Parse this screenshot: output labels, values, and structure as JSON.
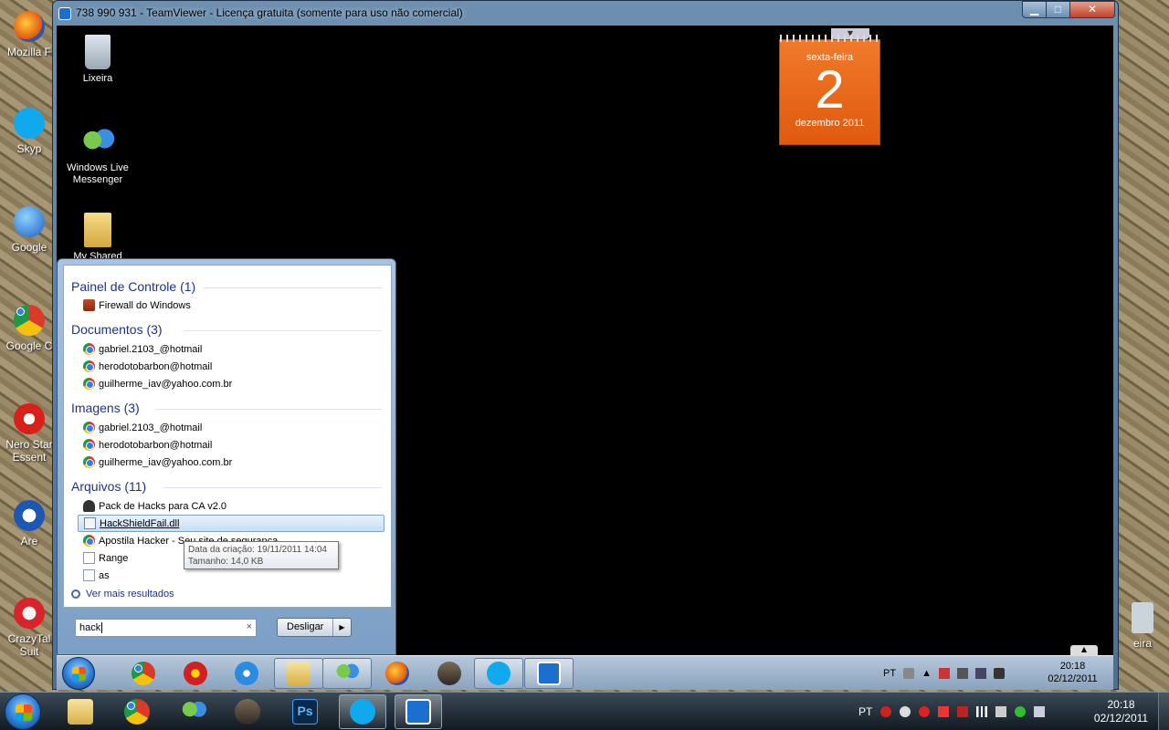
{
  "outer_desktop": {
    "icons": [
      {
        "label": "Mozilla F",
        "icon": "firefox-icon"
      },
      {
        "label": "Skyp",
        "icon": "skype-icon"
      },
      {
        "label": "Google",
        "icon": "google-earth-icon"
      },
      {
        "label": "Google C",
        "icon": "chrome-icon"
      },
      {
        "label": "Nero Star\nEssent",
        "icon": "nero-icon"
      },
      {
        "label": "Are",
        "icon": "ares-icon"
      },
      {
        "label": "CrazyTal\nSuit",
        "icon": "crazytalk-icon"
      }
    ],
    "right_icon_label": "eira"
  },
  "teamviewer": {
    "title": "738 990 931 - TeamViewer - Licença gratuita (somente para uso não comercial)",
    "min_glyph": "▁",
    "max_glyph": "□",
    "close_glyph": "✕"
  },
  "remote_desktop": {
    "icons": [
      {
        "label": "Lixeira",
        "icon": "recycle-bin-icon"
      },
      {
        "label": "Windows Live\nMessenger",
        "icon": "messenger-icon"
      },
      {
        "label": "My Shared Folder",
        "icon": "shared-folder-icon"
      }
    ],
    "calendar": {
      "weekday": "sexta-feira",
      "day": "2",
      "month_year": "dezembro 2011"
    }
  },
  "start_menu": {
    "groups": [
      {
        "title": "Painel de Controle (1)",
        "items": [
          {
            "label": "Firewall do Windows",
            "icon": "firewall-icon"
          }
        ]
      },
      {
        "title": "Documentos (3)",
        "items": [
          {
            "label": "gabriel.2103_@hotmail",
            "icon": "chrome-icon"
          },
          {
            "label": "herodotobarbon@hotmail",
            "icon": "chrome-icon"
          },
          {
            "label": "guilherme_iav@yahoo.com.br",
            "icon": "chrome-icon"
          }
        ]
      },
      {
        "title": "Imagens (3)",
        "items": [
          {
            "label": "gabriel.2103_@hotmail",
            "icon": "chrome-icon"
          },
          {
            "label": "herodotobarbon@hotmail",
            "icon": "chrome-icon"
          },
          {
            "label": "guilherme_iav@yahoo.com.br",
            "icon": "chrome-icon"
          }
        ]
      },
      {
        "title": "Arquivos (11)",
        "items": [
          {
            "label": "Pack de Hacks para CA v2.0",
            "icon": "user-icon"
          },
          {
            "label": "HackShieldFail.dll",
            "icon": "dll-file-icon",
            "selected": true
          },
          {
            "label": "Apostila Hacker - Seu site de segurança",
            "icon": "chrome-icon"
          },
          {
            "label": "Range",
            "icon": "file-icon"
          },
          {
            "label": "as",
            "icon": "file-icon"
          }
        ]
      }
    ],
    "tooltip": {
      "created": "Data da criação: 19/11/2011 14:04",
      "size": "Tamanho: 14,0 KB"
    },
    "more_results": "Ver mais resultados",
    "search": {
      "value": "hack",
      "clear_glyph": "×"
    },
    "shutdown": {
      "label": "Desligar",
      "arrow": "▶"
    }
  },
  "remote_taskbar": {
    "buttons": [
      "start-orb",
      "chrome-icon",
      "pokerstars-icon",
      "internet-explorer-icon",
      "explorer-folder-icon",
      "messenger-icon",
      "firefox-icon",
      "game-icon",
      "skype-icon",
      "teamviewer-icon"
    ],
    "lang": "PT",
    "time": "20:18",
    "date": "02/12/2011"
  },
  "local_taskbar": {
    "buttons": [
      "explorer-folder-icon",
      "chrome-icon",
      "messenger-icon",
      "game-icon",
      "photoshop-icon",
      "skype-icon",
      "teamviewer-icon"
    ],
    "photoshop_label": "Ps",
    "lang": "PT",
    "time": "20:18",
    "date": "02/12/2011"
  },
  "colors": {
    "window_accent": "#4e6f92",
    "calendar_orange": "#e8661a",
    "group_heading": "#1e3287"
  }
}
